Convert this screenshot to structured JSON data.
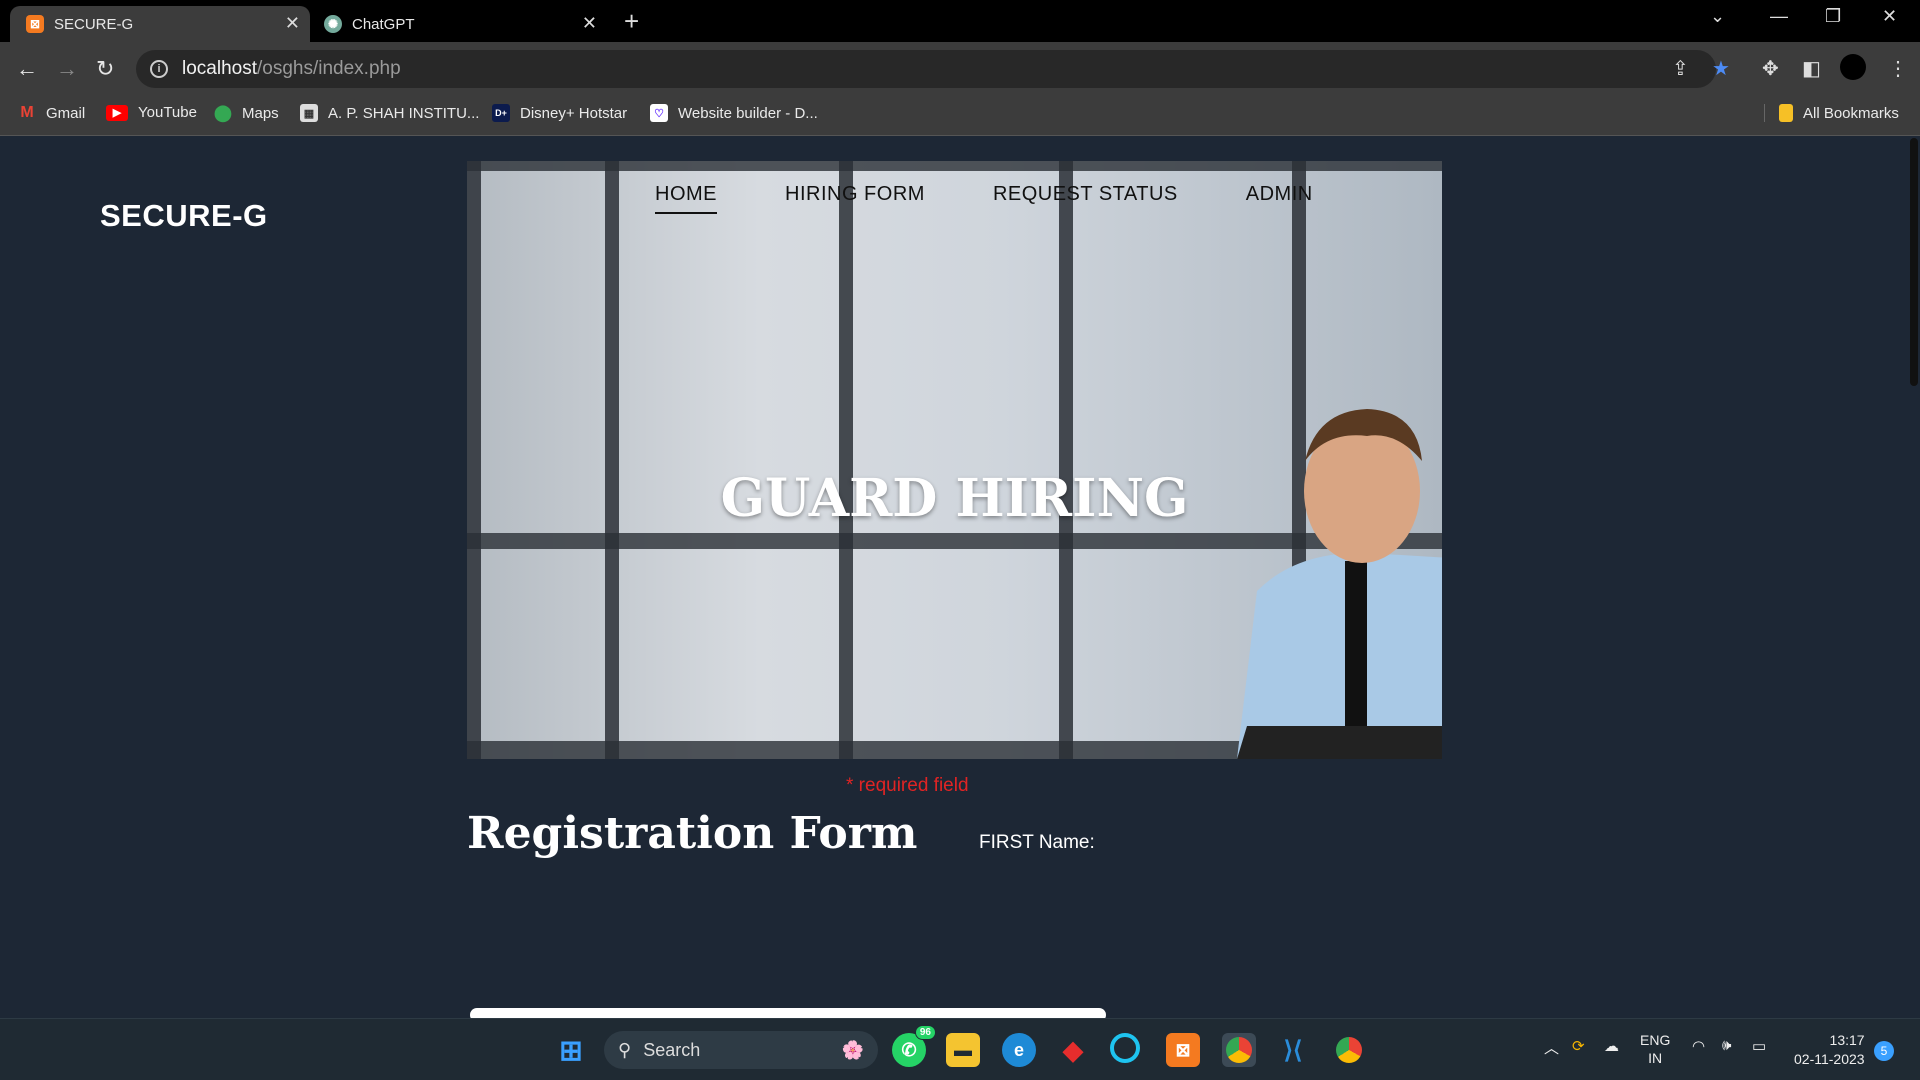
{
  "browser": {
    "tabs": [
      {
        "title": "SECURE-G",
        "active": true
      },
      {
        "title": "ChatGPT",
        "active": false
      }
    ],
    "url_host": "localhost",
    "url_path": "/osghs/index.php",
    "bookmarks": [
      "Gmail",
      "YouTube",
      "Maps",
      "A. P. SHAH INSTITU...",
      "Disney+ Hotstar",
      "Website builder - D..."
    ],
    "all_bookmarks": "All Bookmarks"
  },
  "site": {
    "brand": "SECURE-G",
    "nav": [
      "HOME",
      "HIRING FORM",
      "REQUEST STATUS",
      "ADMIN"
    ],
    "active_nav": "HOME",
    "hero_title": "GUARD HIRING",
    "required_note": "* required field",
    "form_title": "Registration Form",
    "first_name_label": "FIRST Name:"
  },
  "taskbar": {
    "search_label": "Search",
    "whatsapp_badge": "96",
    "lang_top": "ENG",
    "lang_bottom": "IN",
    "time": "13:17",
    "date": "02-11-2023",
    "notification_count": "5"
  },
  "colors": {
    "page_bg": "#1d2735",
    "required": "#e02424",
    "star": "#4c8bf5"
  }
}
